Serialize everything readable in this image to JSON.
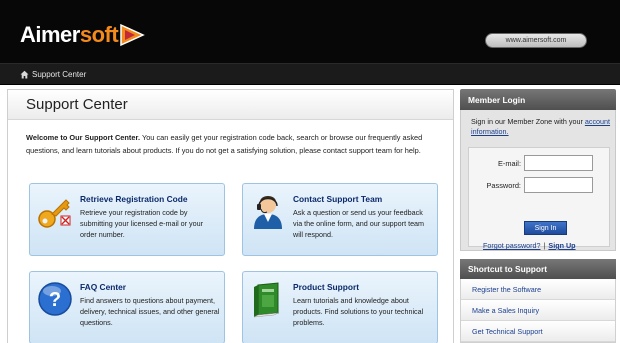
{
  "brand": {
    "logo_part_a": "Aimer",
    "logo_part_b": "soft",
    "url_button": "www.aimersoft.com"
  },
  "breadcrumb": {
    "label": "Support Center"
  },
  "main": {
    "title": "Support Center",
    "intro_bold": "Welcome to Our Support Center.",
    "intro_text": " You can easily get your registration code back, search or browse our frequently asked questions, and learn tutorials about products. If you do not get a satisfying solution, please contact support team for help."
  },
  "cards": [
    {
      "title": "Retrieve Registration Code",
      "desc": "Retrieve your registration code by submitting your licensed e-mail or your order number.",
      "icon": "key-icon"
    },
    {
      "title": "Contact Support Team",
      "desc": "Ask a question or send us your feedback via the online form, and our support team will respond.",
      "icon": "support-agent-icon"
    },
    {
      "title": "FAQ Center",
      "desc": "Find answers to questions about payment, delivery, technical issues, and other general questions.",
      "icon": "question-icon"
    },
    {
      "title": "Product Support",
      "desc": "Learn tutorials and knowledge about products. Find solutions to your technical problems.",
      "icon": "book-icon"
    }
  ],
  "login": {
    "heading": "Member Login",
    "text": "Sign in our Member Zone with your ",
    "text_link": "account information.",
    "email_label": "E-mail:",
    "password_label": "Password:",
    "email_value": "",
    "password_value": "",
    "signin_label": "Sign In",
    "forgot_label": "Forgot password?",
    "separator": "|",
    "signup_label": "Sign Up"
  },
  "shortcut": {
    "heading": "Shortcut to Support",
    "items": [
      "Register the Software",
      "Make a Sales Inquiry",
      "Get Technical Support"
    ]
  },
  "colors": {
    "header_bg": "#070707",
    "brand_orange": "#f28a1c",
    "card_title": "#0c2a6b",
    "link": "#1b3f8f",
    "signin": "#2a5cb2"
  }
}
